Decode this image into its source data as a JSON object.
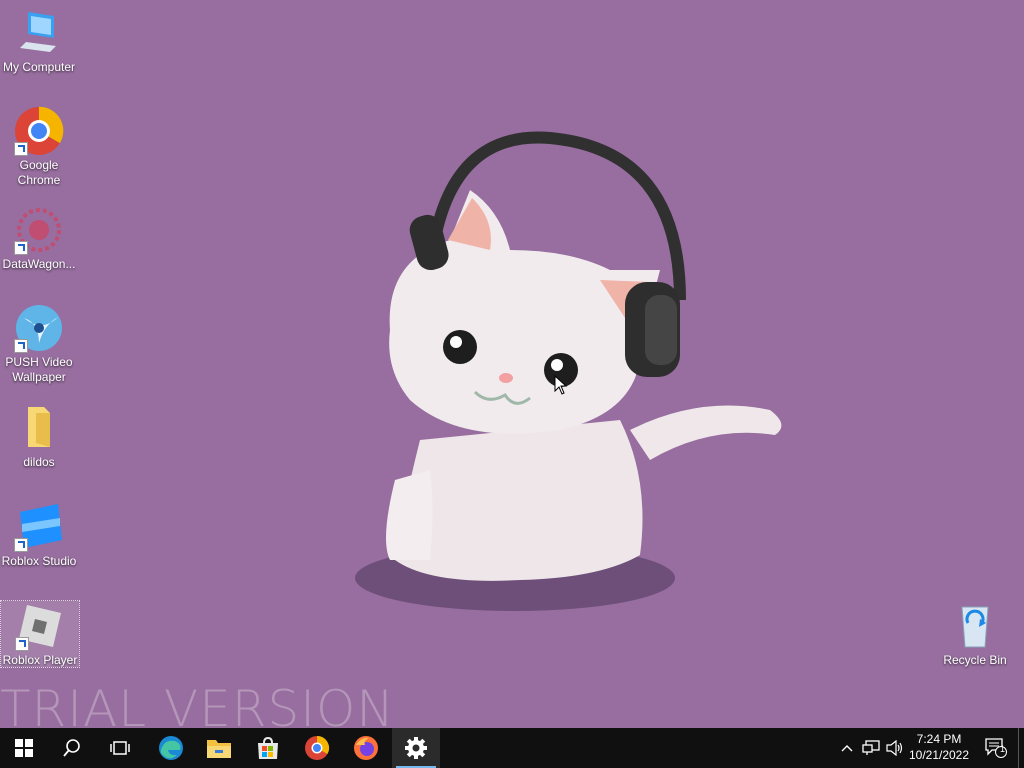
{
  "desktop": {
    "icons": [
      {
        "label": "My Computer"
      },
      {
        "label": "Google Chrome"
      },
      {
        "label": "DataWagon..."
      },
      {
        "label": "PUSH Video Wallpaper"
      },
      {
        "label": "dildos"
      },
      {
        "label": "Roblox Studio"
      },
      {
        "label": "Roblox Player"
      },
      {
        "label": "Recycle Bin"
      }
    ],
    "watermark": "TRIAL VERSION"
  },
  "taskbar": {
    "pinned": [
      "start-icon",
      "search-icon",
      "task-view-icon",
      "edge-icon",
      "file-explorer-icon",
      "store-icon",
      "chrome-icon",
      "firefox-icon",
      "settings-icon"
    ],
    "clock": {
      "time": "7:24 PM",
      "date": "10/21/2022"
    },
    "notification_count": "1"
  }
}
